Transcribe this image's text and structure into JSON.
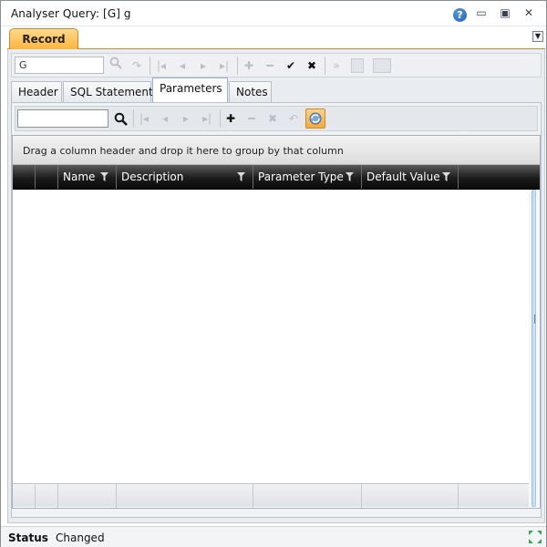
{
  "window": {
    "title": "Analyser Query: [G] g",
    "help_glyph": "?",
    "minimize_glyph": "▭",
    "maximize_glyph": "▣",
    "close_glyph": "✕"
  },
  "record_tab": {
    "label": "Record",
    "dropdown_glyph": "▼"
  },
  "record_toolbar": {
    "search_value": "G",
    "search_placeholder": "",
    "icons": {
      "search": "🔍",
      "redo": "↷",
      "first": "|◂",
      "prev": "◂",
      "next": "▸",
      "last": "▸|",
      "add": "✚",
      "remove": "━",
      "confirm": "✔",
      "cancel": "✖",
      "forward": "»"
    }
  },
  "inner_tabs": [
    {
      "label": "Header"
    },
    {
      "label": "SQL Statement"
    },
    {
      "label": "Parameters",
      "selected": true
    },
    {
      "label": "Notes"
    }
  ],
  "parameters_toolbar": {
    "search_value": "",
    "search_placeholder": "",
    "icons": {
      "search": "🔍",
      "first": "|◂",
      "prev": "◂",
      "next": "▸",
      "last": "▸|",
      "add": "✚",
      "remove": "━",
      "delete": "✖",
      "undo": "↶"
    }
  },
  "grid": {
    "group_hint": "Drag a column header and drop it here to group by that column",
    "columns": [
      {
        "label": ""
      },
      {
        "label": ""
      },
      {
        "label": "Name"
      },
      {
        "label": "Description"
      },
      {
        "label": "Parameter Type"
      },
      {
        "label": "Default Value"
      },
      {
        "label": ""
      }
    ],
    "rows": []
  },
  "status": {
    "label": "Status",
    "value": "Changed"
  },
  "colors": {
    "record_tab_orange": "#fbb540",
    "grid_header_dark": "#1c1c1c",
    "selection_blue": "#b8d3f2"
  }
}
